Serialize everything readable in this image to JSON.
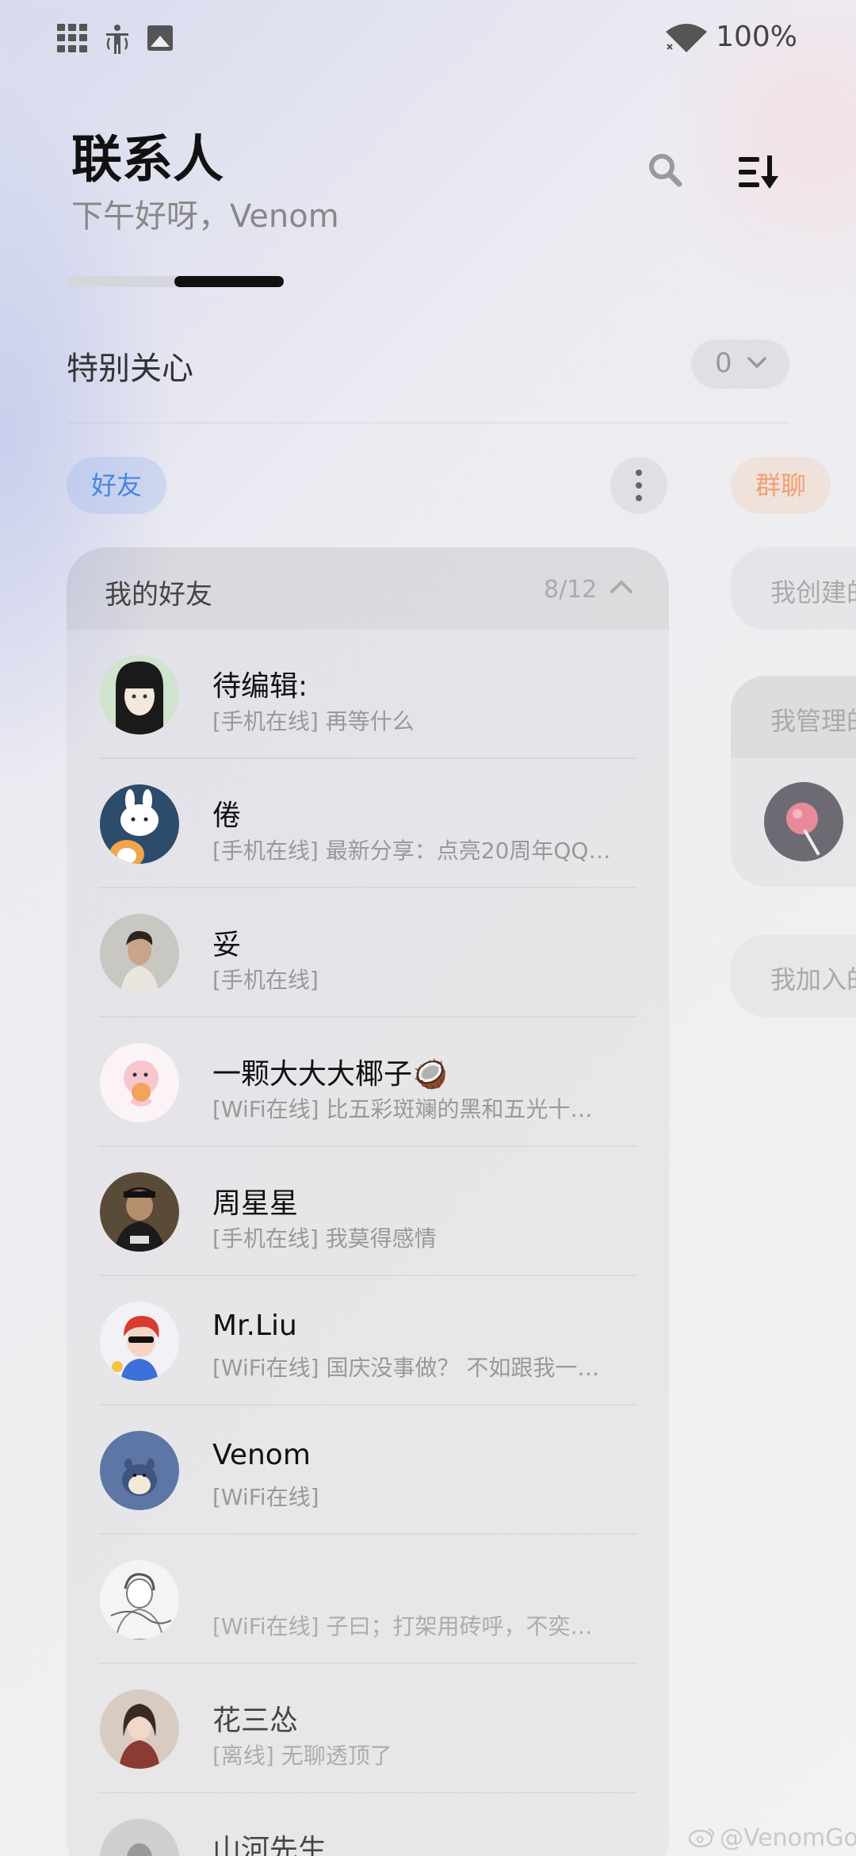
{
  "status_bar": {
    "battery": "100%",
    "icons": [
      "apps-grid-icon",
      "figure-icon",
      "image-icon",
      "wifi-icon"
    ]
  },
  "header": {
    "title": "联系人",
    "greeting": "下午好呀，Venom"
  },
  "special": {
    "label": "特别关心",
    "count": "0"
  },
  "tabs": {
    "friends": "好友",
    "groups": "群聊"
  },
  "friend_group": {
    "title": "我的好友",
    "count": "8/12"
  },
  "friends": [
    {
      "name": "待编辑:",
      "status": "[手机在线] 再等什么"
    },
    {
      "name": "倦",
      "status": "[手机在线] 最新分享：点亮20周年QQ…"
    },
    {
      "name": "妥",
      "status": "[手机在线]"
    },
    {
      "name": "一颗大大大椰子🥥",
      "status": "[WiFi在线] 比五彩斑斓的黑和五光十…"
    },
    {
      "name": "周星星",
      "status": "[手机在线] 我莫得感情"
    },
    {
      "name": "Mr.Liu",
      "status": "[WiFi在线] 国庆没事做？ 不如跟我一…"
    },
    {
      "name": "Venom",
      "status": "[WiFi在线]"
    },
    {
      "name": "",
      "status": "[WiFi在线] 子曰；打架用砖呼，不奕…"
    },
    {
      "name": "花三怂",
      "status": "[离线] 无聊透顶了"
    },
    {
      "name": "山河先生",
      "status": ""
    }
  ],
  "group_sections": {
    "created": "我创建的",
    "managed": "我管理的",
    "joined": "我加入的"
  },
  "watermark": "@VenomGo",
  "colors": {
    "friends_tab": "#4a86e0",
    "groups_tab": "#f0a070",
    "pager_active": "#111111"
  }
}
